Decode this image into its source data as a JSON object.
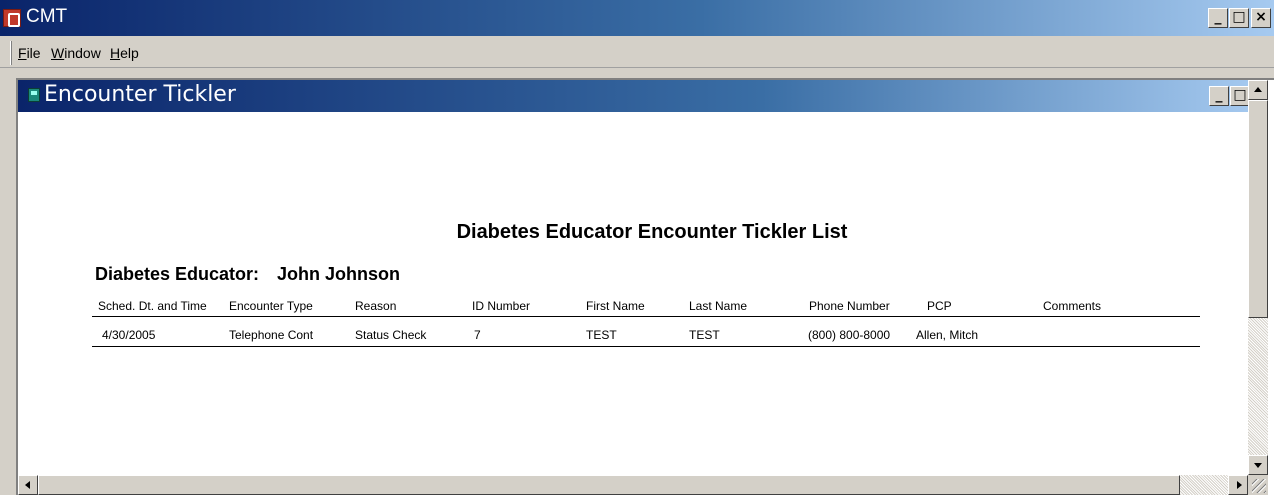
{
  "app": {
    "title": "CMT"
  },
  "menu": {
    "file": "File",
    "window": "Window",
    "help": "Help"
  },
  "child": {
    "title": "Encounter Tickler"
  },
  "report": {
    "title": "Diabetes Educator Encounter Tickler List",
    "educator_label": "Diabetes Educator:",
    "educator_name": "John Johnson",
    "columns": [
      "Sched. Dt. and Time",
      "Encounter Type",
      "Reason",
      "ID Number",
      "First Name",
      "Last Name",
      "Phone Number",
      "PCP",
      "Comments"
    ],
    "rows": [
      [
        "4/30/2005",
        "Telephone Cont",
        "Status Check",
        "7",
        "TEST",
        "TEST",
        "(800) 800-8000",
        "Allen, Mitch",
        ""
      ]
    ]
  },
  "icons": {
    "app": "cmt-app-icon",
    "child": "window-document-icon",
    "minimize": "minimize-icon",
    "maximize": "maximize-icon",
    "close": "close-icon"
  }
}
